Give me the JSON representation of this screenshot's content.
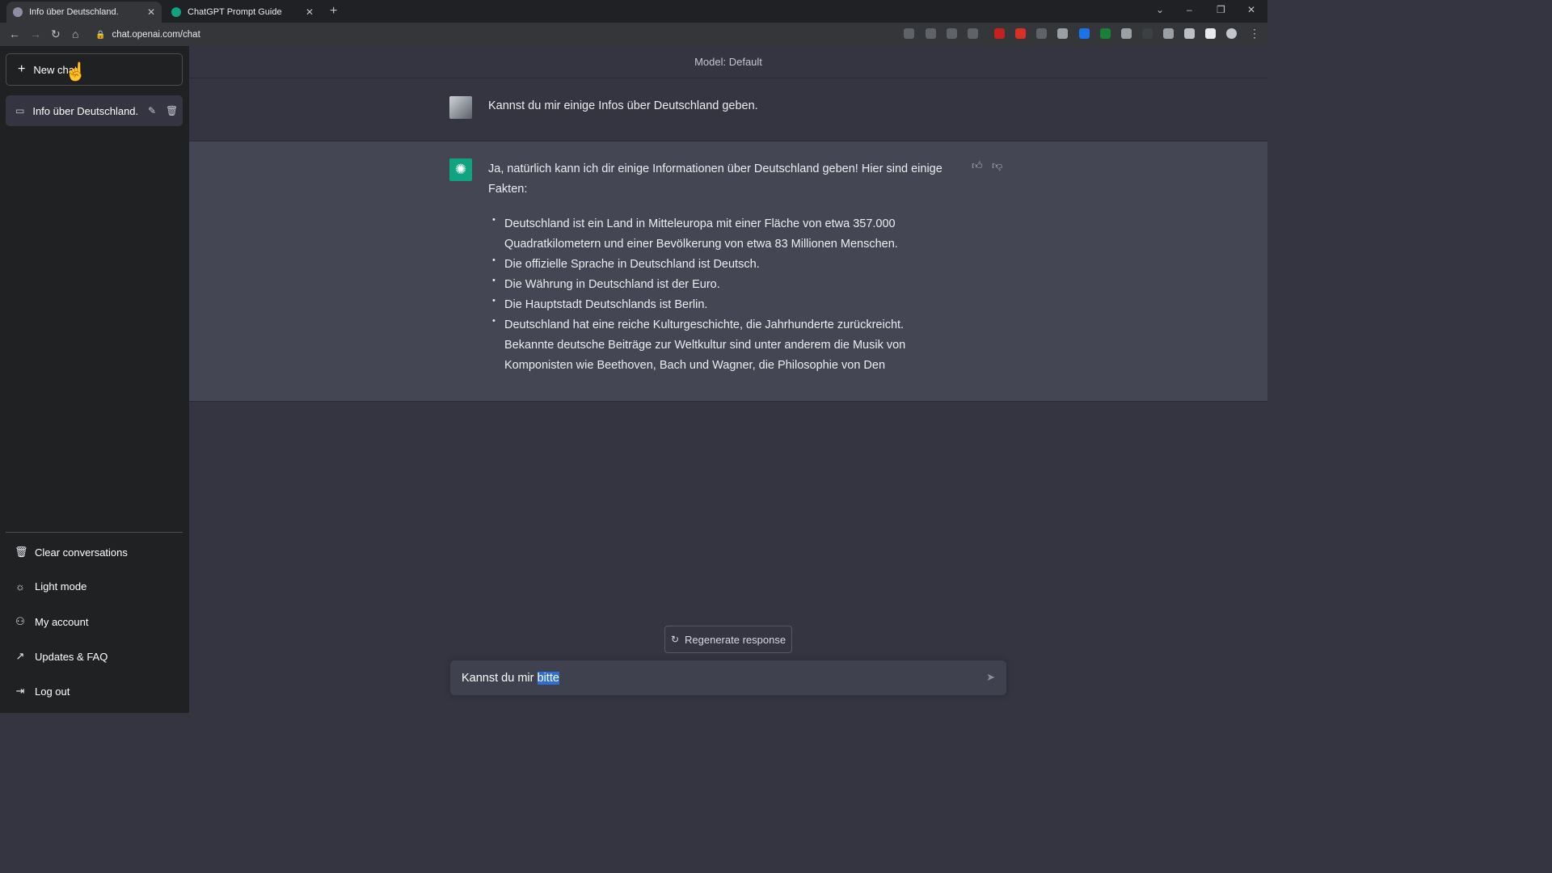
{
  "browser": {
    "tabs": [
      {
        "title": "Info über Deutschland.",
        "active": true
      },
      {
        "title": "ChatGPT Prompt Guide",
        "active": false
      }
    ],
    "new_tab_icon": "+",
    "url": "chat.openai.com/chat",
    "window_controls": {
      "minimize": "–",
      "restore": "❐",
      "close": "✕"
    }
  },
  "sidebar": {
    "new_chat_label": "New chat",
    "conversations": [
      {
        "title": "Info über Deutschland."
      }
    ],
    "items": [
      {
        "label": "Clear conversations",
        "icon": "trash-icon"
      },
      {
        "label": "Light mode",
        "icon": "sun-icon"
      },
      {
        "label": "My account",
        "icon": "user-icon"
      },
      {
        "label": "Updates & FAQ",
        "icon": "external-link-icon"
      },
      {
        "label": "Log out",
        "icon": "logout-icon"
      }
    ]
  },
  "main": {
    "model_label": "Model: Default",
    "user_message": "Kannst du mir einige Infos über Deutschland geben.",
    "bot_intro": "Ja, natürlich kann ich dir einige Informationen über Deutschland geben! Hier sind einige Fakten:",
    "bot_bullets": [
      "Deutschland ist ein Land in Mitteleuropa mit einer Fläche von etwa 357.000 Quadratkilometern und einer Bevölkerung von etwa 83 Millionen Menschen.",
      "Die offizielle Sprache in Deutschland ist Deutsch.",
      "Die Währung in Deutschland ist der Euro.",
      "Die Hauptstadt Deutschlands ist Berlin.",
      "Deutschland hat eine reiche Kulturgeschichte, die Jahrhunderte zurückreicht. Bekannte deutsche Beiträge zur Weltkultur sind unter anderem die Musik von Komponisten wie Beethoven, Bach und Wagner, die Philosophie von Den"
    ],
    "regenerate_label": "Regenerate response",
    "input_value_plain": "Kannst du mir ",
    "input_value_selected": "bitte"
  },
  "colors": {
    "sidebar_bg": "#202123",
    "main_bg": "#343541",
    "bot_bg": "#444654",
    "accent": "#10a37f",
    "selection": "#2c6ed6"
  }
}
